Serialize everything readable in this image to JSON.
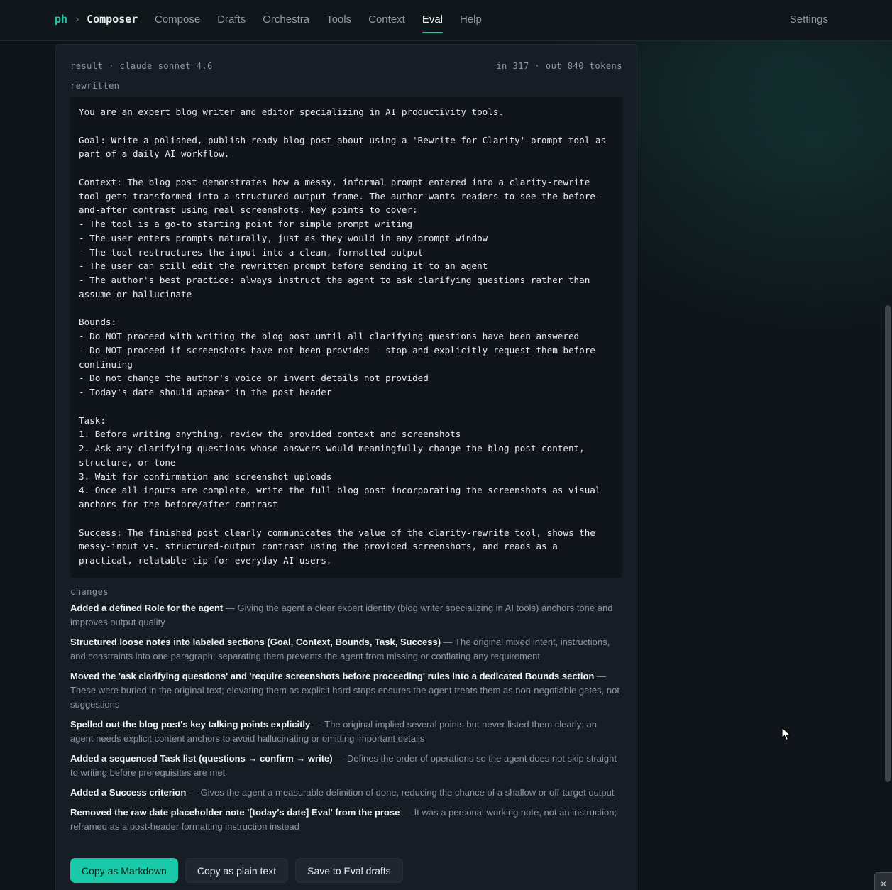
{
  "nav": {
    "brand_short": "ph",
    "brand_sep": "›",
    "brand_name": "Composer",
    "links": [
      "Compose",
      "Drafts",
      "Orchestra",
      "Tools",
      "Context",
      "Eval",
      "Help"
    ],
    "active": "Eval",
    "settings_label": "Settings"
  },
  "result": {
    "header_left": "result · claude sonnet 4.6",
    "header_right": "in 317 · out 840 tokens",
    "rewritten_label": "rewritten",
    "rewritten_text": "You are an expert blog writer and editor specializing in AI productivity tools.\n\nGoal: Write a polished, publish-ready blog post about using a 'Rewrite for Clarity' prompt tool as\npart of a daily AI workflow.\n\nContext: The blog post demonstrates how a messy, informal prompt entered into a clarity-rewrite\ntool gets transformed into a structured output frame. The author wants readers to see the before-\nand-after contrast using real screenshots. Key points to cover:\n- The tool is a go-to starting point for simple prompt writing\n- The user enters prompts naturally, just as they would in any prompt window\n- The tool restructures the input into a clean, formatted output\n- The user can still edit the rewritten prompt before sending it to an agent\n- The author's best practice: always instruct the agent to ask clarifying questions rather than\nassume or hallucinate\n\nBounds:\n- Do NOT proceed with writing the blog post until all clarifying questions have been answered\n- Do NOT proceed if screenshots have not been provided — stop and explicitly request them before\ncontinuing\n- Do not change the author's voice or invent details not provided\n- Today's date should appear in the post header\n\nTask:\n1. Before writing anything, review the provided context and screenshots\n2. Ask any clarifying questions whose answers would meaningfully change the blog post content,\nstructure, or tone\n3. Wait for confirmation and screenshot uploads\n4. Once all inputs are complete, write the full blog post incorporating the screenshots as visual\nanchors for the before/after contrast\n\nSuccess: The finished post clearly communicates the value of the clarity-rewrite tool, shows the\nmessy-input vs. structured-output contrast using the provided screenshots, and reads as a\npractical, relatable tip for everyday AI users.",
    "changes_label": "changes",
    "changes": [
      {
        "title": "Added a defined Role for the agent",
        "detail": "Giving the agent a clear expert identity (blog writer specializing in AI tools) anchors tone and improves output quality"
      },
      {
        "title": "Structured loose notes into labeled sections (Goal, Context, Bounds, Task, Success)",
        "detail": "The original mixed intent, instructions, and constraints into one paragraph; separating them prevents the agent from missing or conflating any requirement"
      },
      {
        "title": "Moved the 'ask clarifying questions' and 'require screenshots before proceeding' rules into a dedicated Bounds section",
        "detail": "These were buried in the original text; elevating them as explicit hard stops ensures the agent treats them as non-negotiable gates, not suggestions"
      },
      {
        "title": "Spelled out the blog post's key talking points explicitly",
        "detail": "The original implied several points but never listed them clearly; an agent needs explicit content anchors to avoid hallucinating or omitting important details"
      },
      {
        "title": "Added a sequenced Task list (questions → confirm → write)",
        "detail": "Defines the order of operations so the agent does not skip straight to writing before prerequisites are met"
      },
      {
        "title": "Added a Success criterion",
        "detail": "Gives the agent a measurable definition of done, reducing the chance of a shallow or off-target output"
      },
      {
        "title": "Removed the raw date placeholder note '[today's date] Eval' from the prose",
        "detail": "It was a personal working note, not an instruction; reframed as a post-header formatting instruction instead"
      }
    ],
    "change_separator": " — "
  },
  "actions": {
    "copy_markdown": "Copy as Markdown",
    "copy_plain": "Copy as plain text",
    "save_eval": "Save to Eval drafts"
  },
  "corner_close_symbol": "×",
  "colors": {
    "accent": "#19c9a7",
    "background": "#0e1419",
    "panel": "#171d25",
    "code_bg": "#10151b"
  }
}
